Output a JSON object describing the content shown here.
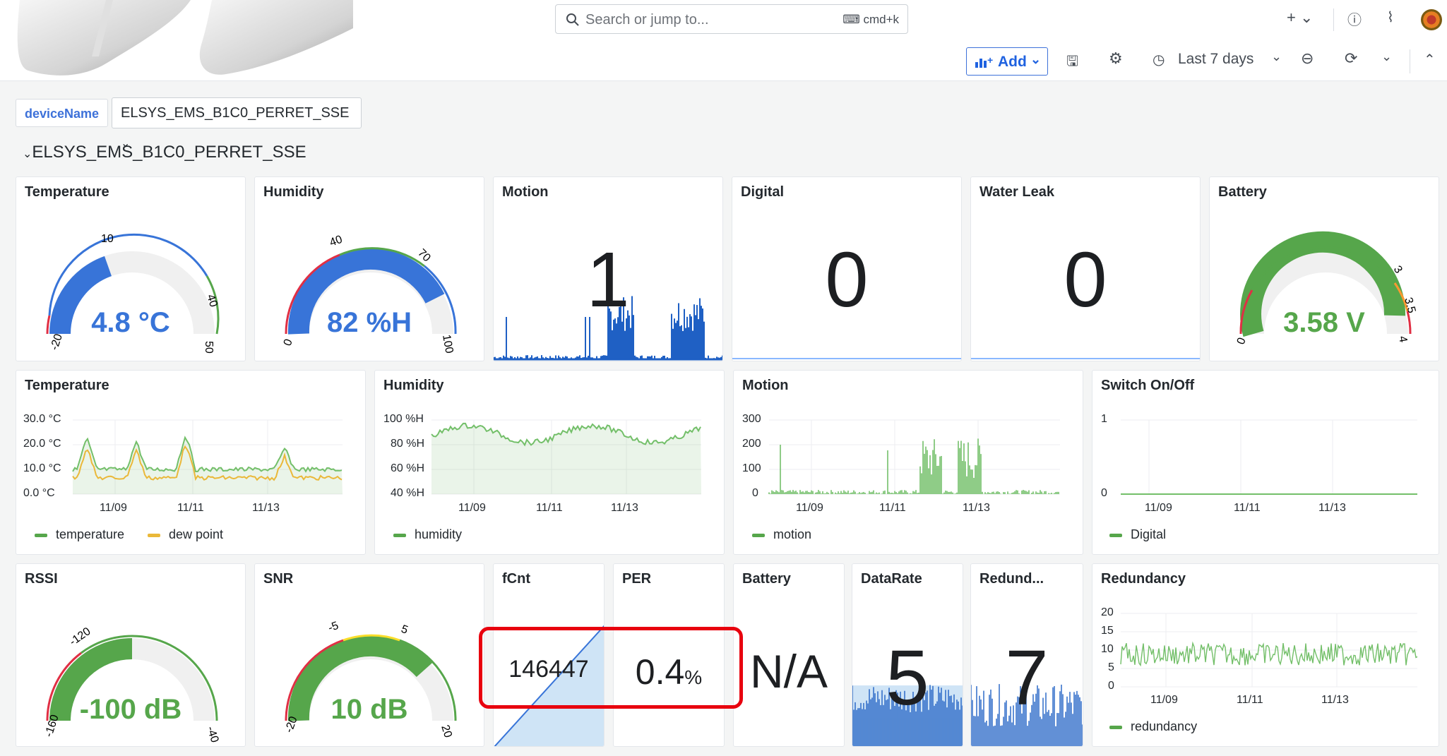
{
  "search": {
    "placeholder": "Search or jump to...",
    "shortcut": "cmd+k"
  },
  "toolbar": {
    "add_label": "Add",
    "time_range": "Last 7 days"
  },
  "variables": {
    "label": "deviceName",
    "value": "ELSYS_EMS_B1C0_PERRET_SSE"
  },
  "row": {
    "title": "ELSYS_EMS_B1C0_PERRET_SSE"
  },
  "colors": {
    "blue": "#3874d8",
    "green": "#56a64b",
    "red": "#e02f44",
    "orange": "#ff9830",
    "yellow": "#fade2a",
    "panel_bg": "#ffffff",
    "page_bg": "#f4f5f5"
  },
  "panels": {
    "temperature_gauge": {
      "title": "Temperature",
      "value": "4.8 °C",
      "ticks": [
        "-20",
        "10",
        "40",
        "50"
      ]
    },
    "humidity_gauge": {
      "title": "Humidity",
      "value": "82 %H",
      "ticks": [
        "0",
        "40",
        "70",
        "100"
      ]
    },
    "motion_stat": {
      "title": "Motion",
      "value": "1"
    },
    "digital_stat": {
      "title": "Digital",
      "value": "0"
    },
    "water_leak_stat": {
      "title": "Water Leak",
      "value": "0"
    },
    "battery_gauge": {
      "title": "Battery",
      "value": "3.58 V",
      "ticks": [
        "0",
        "3",
        "3.5",
        "4"
      ]
    },
    "temperature_ts": {
      "title": "Temperature",
      "yticks": [
        "30.0 °C",
        "20.0 °C",
        "10.0 °C",
        "0.0 °C"
      ],
      "xticks": [
        "11/09",
        "11/11",
        "11/13"
      ],
      "legend": [
        "temperature",
        "dew point"
      ]
    },
    "humidity_ts": {
      "title": "Humidity",
      "yticks": [
        "100 %H",
        "80 %H",
        "60 %H",
        "40 %H"
      ],
      "xticks": [
        "11/09",
        "11/11",
        "11/13"
      ],
      "legend": [
        "humidity"
      ]
    },
    "motion_ts": {
      "title": "Motion",
      "yticks": [
        "300",
        "200",
        "100",
        "0"
      ],
      "xticks": [
        "11/09",
        "11/11",
        "11/13"
      ],
      "legend": [
        "motion"
      ]
    },
    "switch_ts": {
      "title": "Switch On/Off",
      "yticks": [
        "1",
        "0"
      ],
      "xticks": [
        "11/09",
        "11/11",
        "11/13"
      ],
      "legend": [
        "Digital"
      ]
    },
    "rssi_gauge": {
      "title": "RSSI",
      "value": "-100 dB",
      "ticks": [
        "-160",
        "-120",
        "-40"
      ]
    },
    "snr_gauge": {
      "title": "SNR",
      "value": "10 dB",
      "ticks": [
        "-20",
        "-5",
        "5",
        "20"
      ]
    },
    "fcnt_stat": {
      "title": "fCnt",
      "value": "146447"
    },
    "per_stat": {
      "title": "PER",
      "value": "0.4",
      "unit": "%"
    },
    "battery_stat": {
      "title": "Battery",
      "value": "N/A"
    },
    "datarate_stat": {
      "title": "DataRate",
      "value": "5"
    },
    "redundancy_stat": {
      "title": "Redund...",
      "value": "7"
    },
    "redundancy_ts": {
      "title": "Redundancy",
      "yticks": [
        "20",
        "15",
        "10",
        "5",
        "0"
      ],
      "xticks": [
        "11/09",
        "11/11",
        "11/13"
      ],
      "legend": [
        "redundancy"
      ]
    }
  }
}
